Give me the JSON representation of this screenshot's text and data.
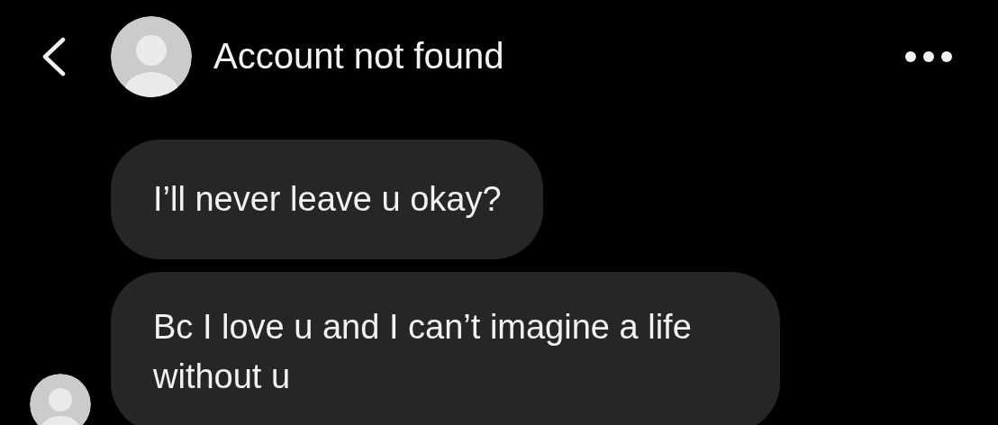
{
  "header": {
    "title": "Account not found"
  },
  "messages": [
    {
      "text": "I’ll never leave u okay?"
    },
    {
      "text": "Bc I love u and I can’t imagine a life without u"
    }
  ]
}
